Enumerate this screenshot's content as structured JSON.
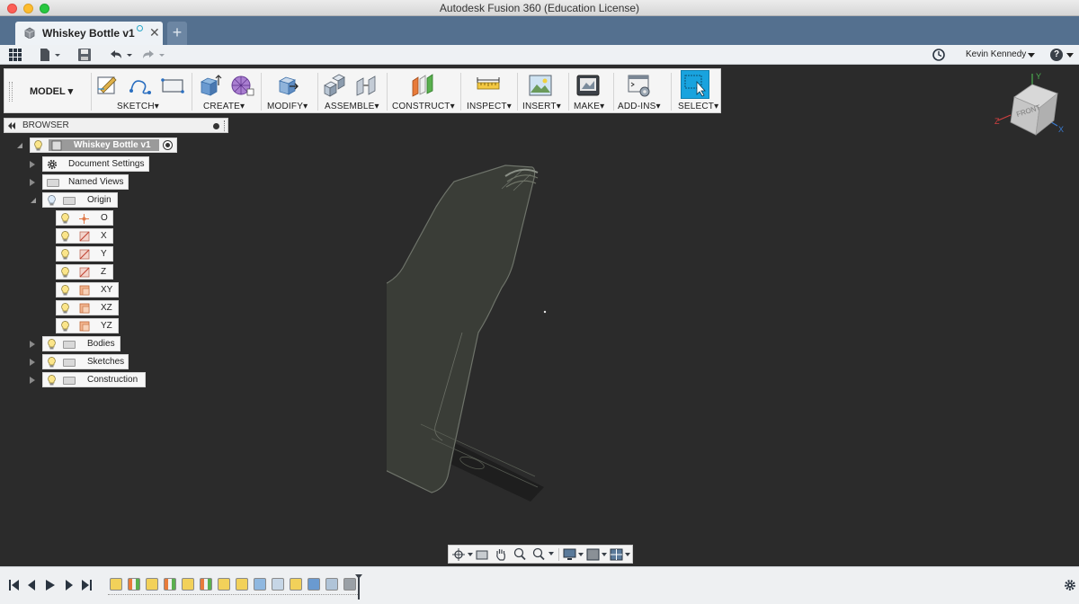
{
  "window": {
    "title": "Autodesk Fusion 360 (Education License)"
  },
  "document_tab": {
    "label": "Whiskey Bottle v1",
    "close": "✕",
    "new_tab": "+"
  },
  "quick_access": {
    "user_name": "Kevin Kennedy",
    "help": "?"
  },
  "toolbar": {
    "workspace": "MODEL",
    "groups": [
      "SKETCH",
      "CREATE",
      "MODIFY",
      "ASSEMBLE",
      "CONSTRUCT",
      "INSPECT",
      "INSERT",
      "MAKE",
      "ADD-INS",
      "SELECT"
    ]
  },
  "browser": {
    "title": "BROWSER",
    "root": "Whiskey Bottle v1",
    "items": [
      "Document Settings",
      "Named Views",
      "Origin",
      "Bodies",
      "Sketches",
      "Construction"
    ],
    "origin_items": [
      "O",
      "X",
      "Y",
      "Z",
      "XY",
      "XZ",
      "YZ"
    ]
  },
  "viewcube": {
    "face": "FRONT",
    "axis_x": "X",
    "axis_y": "Y",
    "axis_z": "Z"
  },
  "colors": {
    "canvas": "#2b2b2b",
    "tab_bar": "#54708f",
    "select_accent": "#19a3de",
    "bottle": "#3a3d37"
  }
}
